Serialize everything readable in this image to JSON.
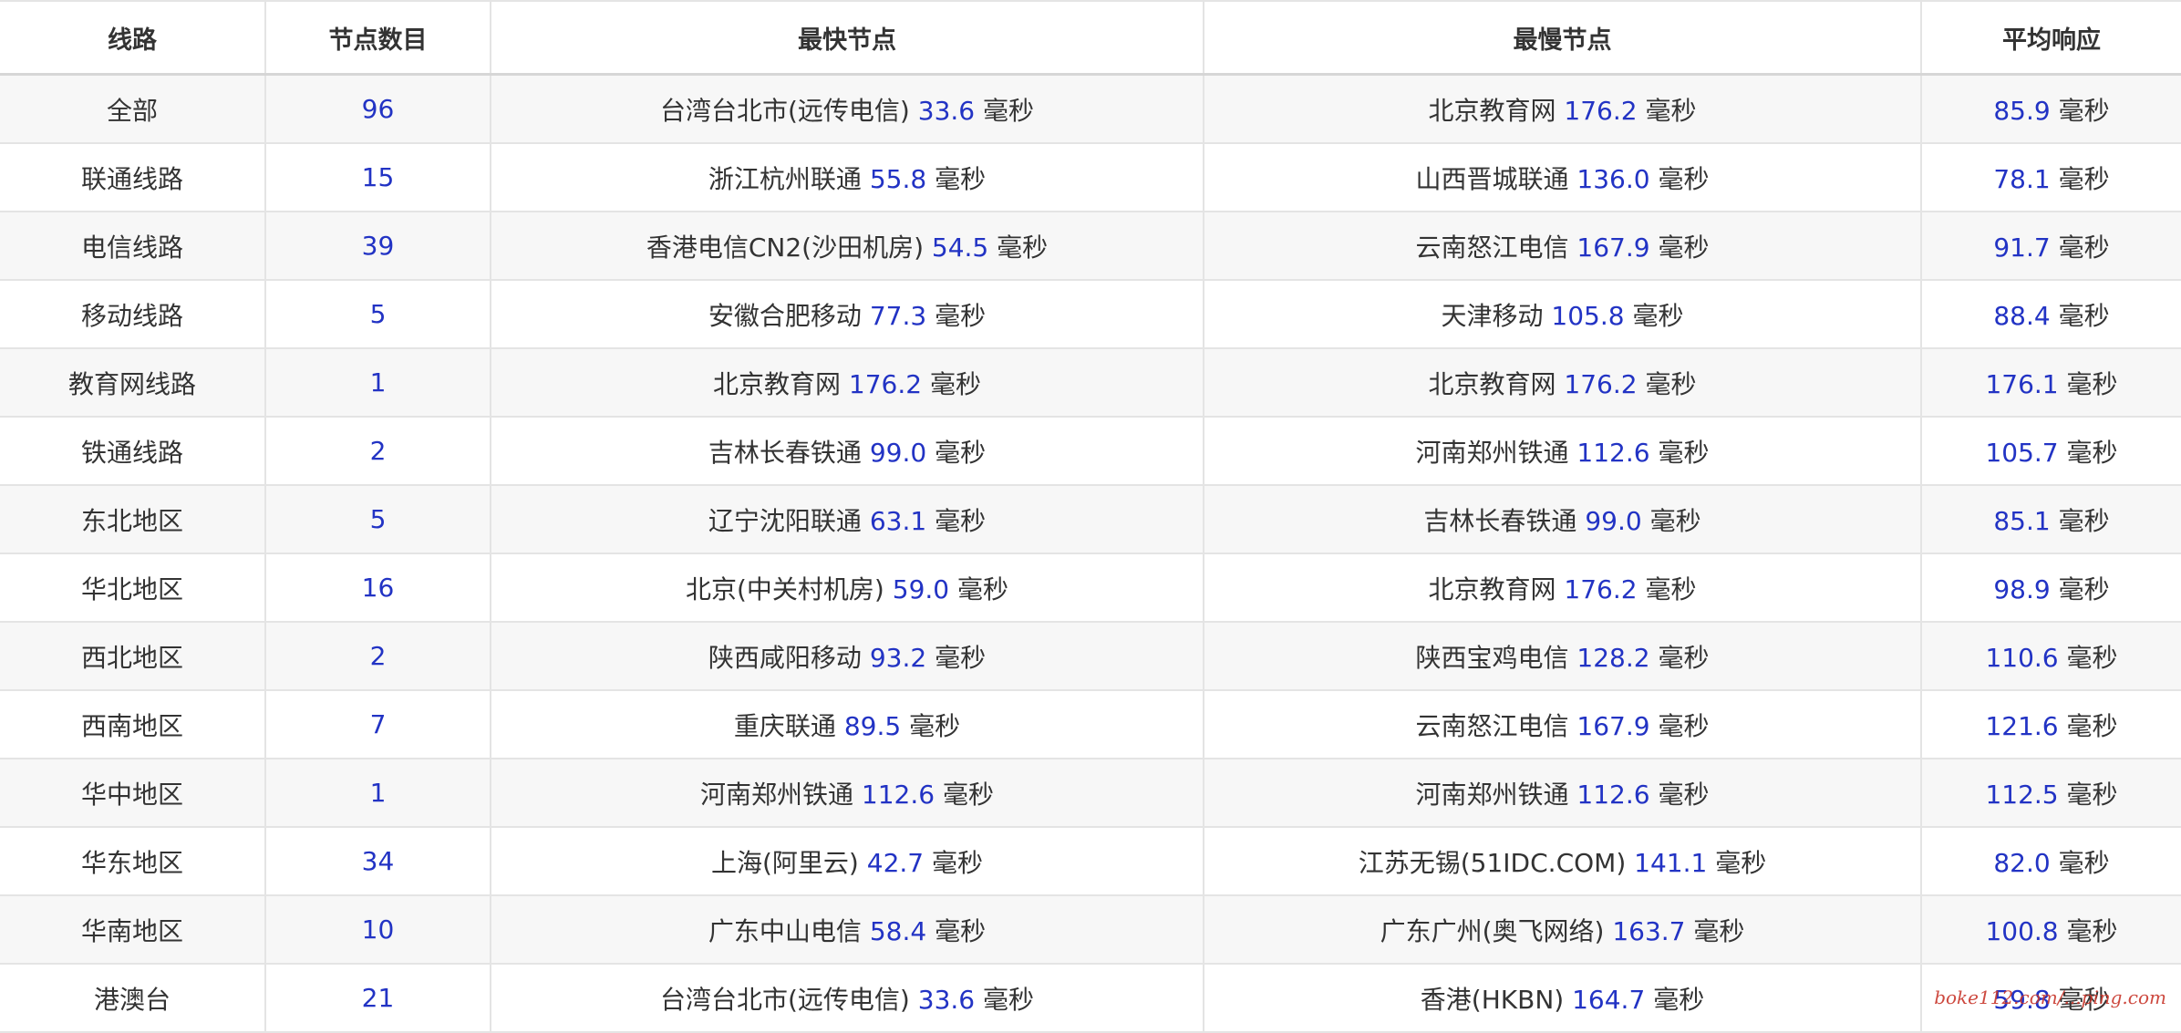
{
  "headers": [
    "线路",
    "节点数目",
    "最快节点",
    "最慢节点",
    "平均响应"
  ],
  "rows": [
    {
      "line": "全部",
      "count": "96",
      "fast_name": "台湾台北市(远传电信)",
      "fast_val": "33.6",
      "fast_unit": "毫秒",
      "slow_name": "北京教育网",
      "slow_val": "176.2",
      "slow_unit": "毫秒",
      "avg_val": "85.9",
      "avg_unit": "毫秒"
    },
    {
      "line": "联通线路",
      "count": "15",
      "fast_name": "浙江杭州联通",
      "fast_val": "55.8",
      "fast_unit": "毫秒",
      "slow_name": "山西晋城联通",
      "slow_val": "136.0",
      "slow_unit": "毫秒",
      "avg_val": "78.1",
      "avg_unit": "毫秒"
    },
    {
      "line": "电信线路",
      "count": "39",
      "fast_name": "香港电信CN2(沙田机房)",
      "fast_val": "54.5",
      "fast_unit": "毫秒",
      "slow_name": "云南怒江电信",
      "slow_val": "167.9",
      "slow_unit": "毫秒",
      "avg_val": "91.7",
      "avg_unit": "毫秒"
    },
    {
      "line": "移动线路",
      "count": "5",
      "fast_name": "安徽合肥移动",
      "fast_val": "77.3",
      "fast_unit": "毫秒",
      "slow_name": "天津移动",
      "slow_val": "105.8",
      "slow_unit": "毫秒",
      "avg_val": "88.4",
      "avg_unit": "毫秒"
    },
    {
      "line": "教育网线路",
      "count": "1",
      "fast_name": "北京教育网",
      "fast_val": "176.2",
      "fast_unit": "毫秒",
      "slow_name": "北京教育网",
      "slow_val": "176.2",
      "slow_unit": "毫秒",
      "avg_val": "176.1",
      "avg_unit": "毫秒"
    },
    {
      "line": "铁通线路",
      "count": "2",
      "fast_name": "吉林长春铁通",
      "fast_val": "99.0",
      "fast_unit": "毫秒",
      "slow_name": "河南郑州铁通",
      "slow_val": "112.6",
      "slow_unit": "毫秒",
      "avg_val": "105.7",
      "avg_unit": "毫秒"
    },
    {
      "line": "东北地区",
      "count": "5",
      "fast_name": "辽宁沈阳联通",
      "fast_val": "63.1",
      "fast_unit": "毫秒",
      "slow_name": "吉林长春铁通",
      "slow_val": "99.0",
      "slow_unit": "毫秒",
      "avg_val": "85.1",
      "avg_unit": "毫秒"
    },
    {
      "line": "华北地区",
      "count": "16",
      "fast_name": "北京(中关村机房)",
      "fast_val": "59.0",
      "fast_unit": "毫秒",
      "slow_name": "北京教育网",
      "slow_val": "176.2",
      "slow_unit": "毫秒",
      "avg_val": "98.9",
      "avg_unit": "毫秒"
    },
    {
      "line": "西北地区",
      "count": "2",
      "fast_name": "陕西咸阳移动",
      "fast_val": "93.2",
      "fast_unit": "毫秒",
      "slow_name": "陕西宝鸡电信",
      "slow_val": "128.2",
      "slow_unit": "毫秒",
      "avg_val": "110.6",
      "avg_unit": "毫秒"
    },
    {
      "line": "西南地区",
      "count": "7",
      "fast_name": "重庆联通",
      "fast_val": "89.5",
      "fast_unit": "毫秒",
      "slow_name": "云南怒江电信",
      "slow_val": "167.9",
      "slow_unit": "毫秒",
      "avg_val": "121.6",
      "avg_unit": "毫秒"
    },
    {
      "line": "华中地区",
      "count": "1",
      "fast_name": "河南郑州铁通",
      "fast_val": "112.6",
      "fast_unit": "毫秒",
      "slow_name": "河南郑州铁通",
      "slow_val": "112.6",
      "slow_unit": "毫秒",
      "avg_val": "112.5",
      "avg_unit": "毫秒"
    },
    {
      "line": "华东地区",
      "count": "34",
      "fast_name": "上海(阿里云)",
      "fast_val": "42.7",
      "fast_unit": "毫秒",
      "slow_name": "江苏无锡(51IDC.COM)",
      "slow_val": "141.1",
      "slow_unit": "毫秒",
      "avg_val": "82.0",
      "avg_unit": "毫秒"
    },
    {
      "line": "华南地区",
      "count": "10",
      "fast_name": "广东中山电信",
      "fast_val": "58.4",
      "fast_unit": "毫秒",
      "slow_name": "广东广州(奥飞网络)",
      "slow_val": "163.7",
      "slow_unit": "毫秒",
      "avg_val": "100.8",
      "avg_unit": "毫秒"
    },
    {
      "line": "港澳台",
      "count": "21",
      "fast_name": "台湾台北市(远传电信)",
      "fast_val": "33.6",
      "fast_unit": "毫秒",
      "slow_name": "香港(HKBN)",
      "slow_val": "164.7",
      "slow_unit": "毫秒",
      "avg_val": "59.8",
      "avg_unit": "毫秒"
    }
  ],
  "watermark": "boke112.com/...ping.com",
  "colors": {
    "value": "#2233c4",
    "text": "#333333",
    "stripe": "#f7f7f7",
    "border": "#e4e4e4",
    "watermark": "#c8362b"
  }
}
